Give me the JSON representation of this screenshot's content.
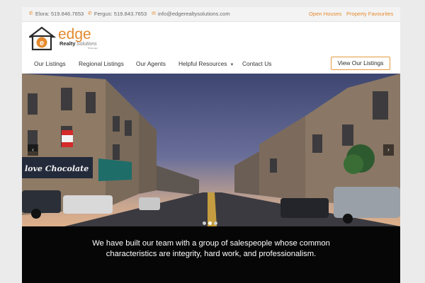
{
  "topbar": {
    "phone_elora": "Elora: 519.846.7653",
    "phone_fergus": "Fergus: 519.843.7653",
    "email": "info@edgerealtysolutions.com",
    "links": [
      "Open Houses",
      "Property Favourites"
    ],
    "phone_icon": "phone-icon",
    "mail_icon": "envelope-icon"
  },
  "logo": {
    "word": "edge",
    "sub_realty": "Realty",
    "sub_solutions": "Solutions",
    "tiny": "Brokerage"
  },
  "nav": {
    "items": [
      "Our Listings",
      "Regional Listings",
      "Our Agents",
      "Helpful Resources",
      "Contact Us"
    ],
    "cta": "View Our Listings"
  },
  "hero": {
    "sign_text": "love Chocolate",
    "arrows": [
      "‹",
      "›"
    ],
    "slide_count": 3,
    "active_slide": 2
  },
  "tagline": {
    "text": "We have built our team with a group of salespeople whose common characteristics are integrity, hard work, and professionalism."
  },
  "colors": {
    "accent": "#e48a2e",
    "page_bg": "#ebebeb",
    "band_bg": "#060606"
  }
}
